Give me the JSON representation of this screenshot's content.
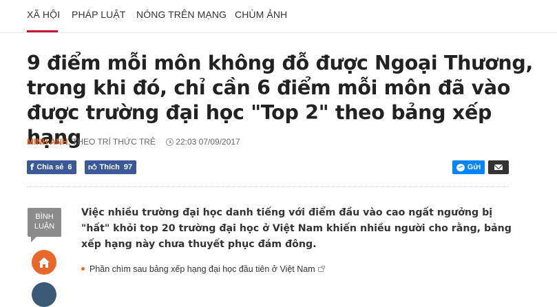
{
  "nav": {
    "items": [
      {
        "label": "XÃ HỘI",
        "active": true
      },
      {
        "label": "PHÁP LUẬT",
        "active": false
      },
      {
        "label": "NÓNG TRÊN MẠNG",
        "active": false
      },
      {
        "label": "CHÙM ẢNH",
        "active": false
      }
    ]
  },
  "article": {
    "title_lines": [
      "9 điểm mỗi môn không đỗ được Ngoại Thương,",
      "trong khi đó, chỉ cần 6 điểm mỗi môn đã vào",
      "được trường đại học \"Top 2\" theo bảng xếp hạng"
    ],
    "author": "MINH ANH",
    "source": ", THEO TRÍ THỨC TRẺ",
    "timestamp": "22:03 07/09/2017",
    "summary": "Việc nhiều trường đại học danh tiếng với điểm đầu vào cao ngất ngưởng bị \"hất\" khỏi top 20 trường đại học ở Việt Nam khiến nhiều người cho rằng, bảng xếp hạng này chưa thuyết phục đám đông.",
    "related_link": "Phần chìm sau bảng xếp hạng đại học đầu tiên ở Việt Nam"
  },
  "share": {
    "fb_share_label": "Chia sẻ",
    "fb_share_count": "6",
    "fb_like_label": "Thích",
    "fb_like_count": "97",
    "send_label": "Gửi"
  },
  "rail": {
    "comment_line1": "BÌNH",
    "comment_line2": "LUẬN"
  },
  "colors": {
    "accent_red": "#c8102e",
    "author_orange": "#e8672b",
    "facebook_blue": "#3b5998",
    "messenger_blue": "#0084ff"
  },
  "icons": [
    "facebook-icon",
    "thumbs-up-icon",
    "messenger-icon",
    "mail-icon",
    "clock-icon",
    "home-icon",
    "external-link-icon"
  ]
}
